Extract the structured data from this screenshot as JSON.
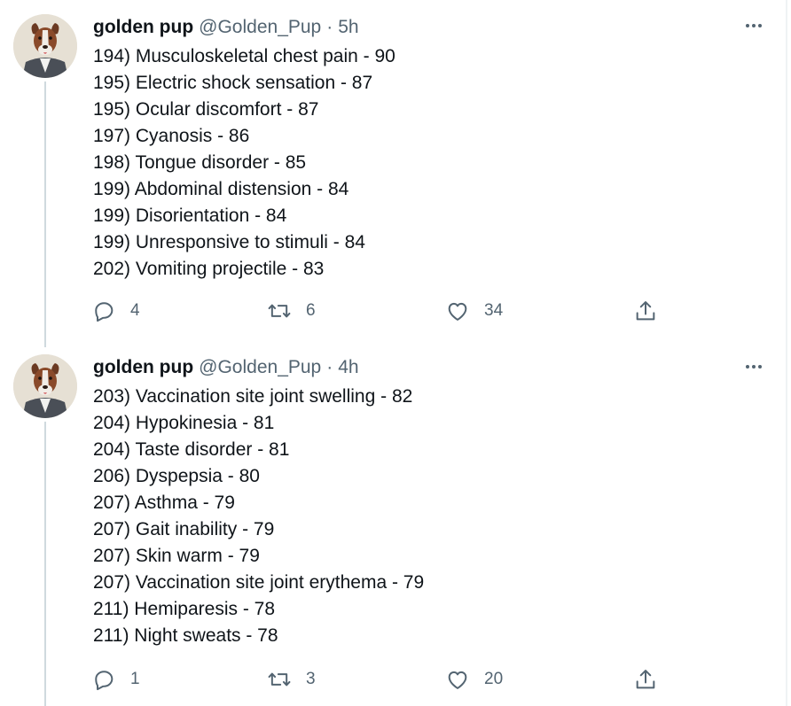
{
  "tweets": [
    {
      "author": {
        "name": "golden pup",
        "handle": "@Golden_Pup"
      },
      "separator": "·",
      "time": "5h",
      "lines": [
        "194) Musculoskeletal chest pain - 90",
        "195) Electric shock sensation - 87",
        "195) Ocular discomfort - 87",
        "197) Cyanosis - 86",
        "198) Tongue disorder - 85",
        "199) Abdominal distension - 84",
        "199) Disorientation - 84",
        "199) Unresponsive to stimuli - 84",
        "202) Vomiting projectile - 83"
      ],
      "counts": {
        "replies": "4",
        "retweets": "6",
        "likes": "34"
      }
    },
    {
      "author": {
        "name": "golden pup",
        "handle": "@Golden_Pup"
      },
      "separator": "·",
      "time": "4h",
      "lines": [
        "203) Vaccination site joint swelling - 82",
        "204) Hypokinesia - 81",
        "204) Taste disorder - 81",
        "206) Dyspepsia - 80",
        "207) Asthma - 79",
        "207) Gait inability - 79",
        "207) Skin warm - 79",
        "207) Vaccination site joint erythema - 79",
        "211) Hemiparesis - 78",
        "211) Night sweats - 78"
      ],
      "counts": {
        "replies": "1",
        "retweets": "3",
        "likes": "20"
      }
    }
  ],
  "icons": {
    "reply": "reply-icon",
    "retweet": "retweet-icon",
    "like": "heart-icon",
    "share": "share-icon",
    "more": "more-options-icon",
    "avatar": "dog-portrait-avatar"
  },
  "colors": {
    "text": "#0f1419",
    "secondary": "#536471",
    "thread_line": "#cfd9de"
  }
}
